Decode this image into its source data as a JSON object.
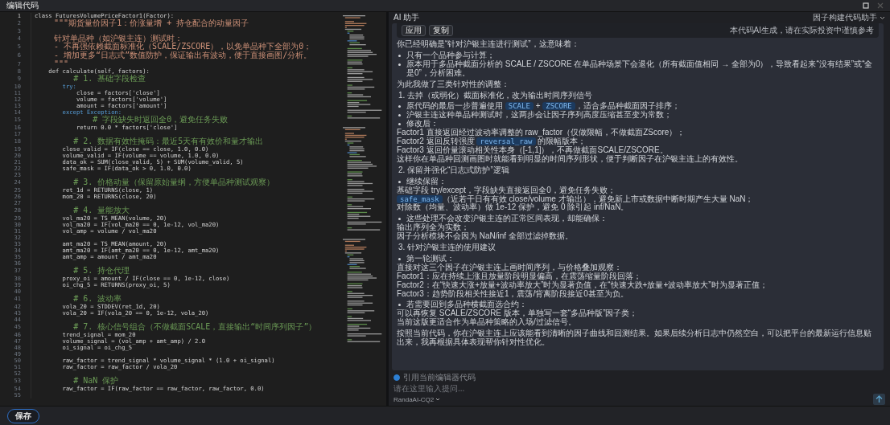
{
  "window": {
    "title": "编辑代码"
  },
  "editor": {
    "lines": [
      {
        "n": "1",
        "kind": "code",
        "text": "class FuturesVolumePriceFactor1(Factor):"
      },
      {
        "n": "2",
        "kind": "doc",
        "text": "    \"\"\"期货量价因子1：价涨量增 + 持仓配合的动量因子"
      },
      {
        "n": "3"
      },
      {
        "n": "4",
        "kind": "doc",
        "text": "    针对单品种（如沪银主连）测试时："
      },
      {
        "n": "5",
        "kind": "doc",
        "text": "    - 不再强依赖截面标准化（SCALE/ZSCORE），以免单品种下全部为0；"
      },
      {
        "n": "6",
        "kind": "doc",
        "text": "    - 增加更多“日志式”数值防护，保证输出有波动，便于直接画图/分析。"
      },
      {
        "n": "7",
        "kind": "doc",
        "text": "    \"\"\""
      },
      {
        "n": "8",
        "kind": "code",
        "text": "    def calculate(self, factors):"
      },
      {
        "n": "9",
        "kind": "comment",
        "text": "        # 1. 基础字段检查"
      },
      {
        "n": "10",
        "kind": "keyword",
        "text": "        try:"
      },
      {
        "n": "11",
        "kind": "code",
        "text": "            close = factors['close']"
      },
      {
        "n": "12",
        "kind": "code",
        "text": "            volume = factors['volume']"
      },
      {
        "n": "13",
        "kind": "code",
        "text": "            amount = factors['amount']"
      },
      {
        "n": "14",
        "kind": "keyword",
        "text": "        except Exception:"
      },
      {
        "n": "15",
        "kind": "comment",
        "text": "            # 字段缺失时返回全0，避免任务失败"
      },
      {
        "n": "16",
        "kind": "code",
        "text": "            return 0.0 * factors['close']"
      },
      {
        "n": "17"
      },
      {
        "n": "18",
        "kind": "comment",
        "text": "        # 2. 数据有效性掩码：最近5天有有效价和量才输出"
      },
      {
        "n": "19",
        "kind": "code",
        "text": "        close_valid = IF(close == close, 1.0, 0.0)"
      },
      {
        "n": "20",
        "kind": "code",
        "text": "        volume_valid = IF(volume == volume, 1.0, 0.0)"
      },
      {
        "n": "21",
        "kind": "code",
        "text": "        data_ok = SUM(close_valid, 5) + SUM(volume_valid, 5)"
      },
      {
        "n": "22",
        "kind": "code",
        "text": "        safe_mask = IF(data_ok > 0, 1.0, 0.0)"
      },
      {
        "n": "23"
      },
      {
        "n": "24",
        "kind": "comment",
        "text": "        # 3. 价格动量（保留原始量纲，方便单品种测试观察）"
      },
      {
        "n": "25",
        "kind": "code",
        "text": "        ret_1d = RETURNS(close, 1)"
      },
      {
        "n": "26",
        "kind": "code",
        "text": "        mom_20 = RETURNS(close, 20)"
      },
      {
        "n": "27"
      },
      {
        "n": "28",
        "kind": "comment",
        "text": "        # 4. 量能放大"
      },
      {
        "n": "29",
        "kind": "code",
        "text": "        vol_ma20 = TS_MEAN(volume, 20)"
      },
      {
        "n": "30",
        "kind": "code",
        "text": "        vol_ma20 = IF(vol_ma20 == 0, 1e-12, vol_ma20)"
      },
      {
        "n": "31",
        "kind": "code",
        "text": "        vol_amp = volume / vol_ma20"
      },
      {
        "n": "32"
      },
      {
        "n": "33",
        "kind": "code",
        "text": "        amt_ma20 = TS_MEAN(amount, 20)"
      },
      {
        "n": "34",
        "kind": "code",
        "text": "        amt_ma20 = IF(amt_ma20 == 0, 1e-12, amt_ma20)"
      },
      {
        "n": "35",
        "kind": "code",
        "text": "        amt_amp = amount / amt_ma20"
      },
      {
        "n": "36"
      },
      {
        "n": "37",
        "kind": "comment",
        "text": "        # 5. 持仓代理"
      },
      {
        "n": "38",
        "kind": "code",
        "text": "        proxy_oi = amount / IF(close == 0, 1e-12, close)"
      },
      {
        "n": "39",
        "kind": "code",
        "text": "        oi_chg_5 = RETURNS(proxy_oi, 5)"
      },
      {
        "n": "40"
      },
      {
        "n": "41",
        "kind": "comment",
        "text": "        # 6. 波动率"
      },
      {
        "n": "42",
        "kind": "code",
        "text": "        vola_20 = STDDEV(ret_1d, 20)"
      },
      {
        "n": "43",
        "kind": "code",
        "text": "        vola_20 = IF(vola_20 == 0, 1e-12, vola_20)"
      },
      {
        "n": "44"
      },
      {
        "n": "45",
        "kind": "comment",
        "text": "        # 7. 核心信号组合（不做截面SCALE，直接输出“时间序列因子”）"
      },
      {
        "n": "46",
        "kind": "code",
        "text": "        trend_signal = mom_20"
      },
      {
        "n": "47",
        "kind": "code",
        "text": "        volume_signal = (vol_amp + amt_amp) / 2.0"
      },
      {
        "n": "48",
        "kind": "code",
        "text": "        oi_signal = oi_chg_5"
      },
      {
        "n": "49"
      },
      {
        "n": "50",
        "kind": "code",
        "text": "        raw_factor = trend_signal * volume_signal * (1.0 + oi_signal)"
      },
      {
        "n": "51",
        "kind": "code",
        "text": "        raw_factor = raw_factor / vola_20"
      },
      {
        "n": "52"
      },
      {
        "n": "53",
        "kind": "comment",
        "text": "        # NaN 保护"
      },
      {
        "n": "54",
        "kind": "code",
        "text": "        raw_factor = IF(raw_factor == raw_factor, raw_factor, 0.0)"
      },
      {
        "n": "55"
      }
    ]
  },
  "assistant": {
    "title": "AI 助手",
    "mode": "因子构建代码助手",
    "card": {
      "buttons": [
        "应用",
        "复制"
      ],
      "note": "本代码AI生成，请在实际投资中谨慎参考"
    },
    "message": [
      [
        {
          "kind": "para",
          "text": "你已经明确是“针对沪银主连进行测试”，这意味着："
        }
      ],
      [
        {
          "kind": "bullet",
          "text": "只有一个品种参与计算；"
        },
        {
          "kind": "bullet",
          "text": "原本用于多品种截面分析的 SCALE / ZSCORE 在单品种场景下会退化（所有截面值相同 → 全部为0），导致看起来“没有结果”或“全是0”，分析困难。"
        }
      ],
      [
        {
          "kind": "para",
          "text": "为此我做了三类针对性的调整："
        }
      ],
      [
        {
          "kind": "heading",
          "text": "1. 去掉（或弱化）截面标准化，改为输出时间序列信号"
        }
      ],
      [
        {
          "kind": "bullet",
          "parts": [
            {
              "text": "原代码的最后一步普遍使用 ",
              "code": false
            },
            {
              "text": "SCALE",
              "code": true
            },
            {
              "text": " + ",
              "code": false
            },
            {
              "text": "ZSCORE",
              "code": true
            },
            {
              "text": "，适合多品种截面因子排序；",
              "code": false
            }
          ]
        },
        {
          "kind": "bullet",
          "text": "沪银主连这种单品种测试时，这两步会让因子序列高度压缩甚至变为常数；"
        },
        {
          "kind": "bullet",
          "text": "修改后："
        },
        {
          "kind": "line",
          "text": "Factor1 直接返回经过波动率调整的 raw_factor（仅做限幅，不做截面ZScore）；"
        },
        {
          "kind": "line",
          "parts": [
            {
              "text": "Factor2 返回反转强度 ",
              "code": false
            },
            {
              "text": "reversal_raw",
              "code": true
            },
            {
              "text": " 的限幅版本；",
              "code": false
            }
          ]
        },
        {
          "kind": "line",
          "text": "Factor3 返回价量滚动相关性本身（[-1,1]），不再做截面SCALE/ZSCORE。"
        },
        {
          "kind": "line",
          "text": "这样你在单品种回测画图时就能看到明显的时间序列形状，便于判断因子在沪银主连上的有效性。"
        }
      ],
      [
        {
          "kind": "heading",
          "text": "2. 保留并强化“日志式防护”逻辑"
        }
      ],
      [
        {
          "kind": "bullet",
          "text": "继续保留："
        },
        {
          "kind": "line",
          "text": "基础字段 try/except，字段缺失直接返回全0，避免任务失败；"
        },
        {
          "kind": "line",
          "parts": [
            {
              "text": "safe_mask",
              "code": true
            },
            {
              "text": "（近若干日有有效 close/volume 才输出），避免新上市或数据中断时期产生大量 NaN；",
              "code": false
            }
          ]
        },
        {
          "kind": "line",
          "text": "对除数（均量、波动率）做 1e-12 保护，避免 0 除引起 inf/NaN。"
        }
      ],
      [
        {
          "kind": "bullet",
          "text": "这些处理不会改变沪银主连的正常区间表现，却能确保："
        },
        {
          "kind": "line",
          "text": "输出序列全为实数；"
        },
        {
          "kind": "line",
          "text": "因子分析模块不会因为 NaN/inf 全部过滤掉数据。"
        }
      ],
      [
        {
          "kind": "heading",
          "text": "3. 针对沪银主连的使用建议"
        }
      ],
      [
        {
          "kind": "bullet",
          "text": "第一轮测试："
        },
        {
          "kind": "line",
          "text": "直接对这三个因子在沪银主连上画时间序列，与价格叠加观察："
        },
        {
          "kind": "line",
          "text": "Factor1：应在持续上涨且放量阶段明显偏高，在震荡缩量阶段回落；"
        },
        {
          "kind": "line",
          "text": "Factor2：在“快速大涨+放量+波动率放大”时为显著负值，在“快速大跌+放量+波动率放大”时为显著正值；"
        },
        {
          "kind": "line",
          "text": "Factor3：趋势阶段相关性接近1，震荡/背离阶段接近0甚至为负。"
        }
      ],
      [
        {
          "kind": "bullet",
          "text": "若需要回到多品种横截面选合约："
        },
        {
          "kind": "line",
          "text": "可以再恢复 SCALE/ZSCORE 版本，单独写一套“多品种版”因子类；"
        },
        {
          "kind": "line",
          "text": "当前这版更适合作为单品种策略的入场/过滤信号。"
        }
      ],
      [
        {
          "kind": "para",
          "text": "按照当前代码，你在沪银主连上应该能看到清晰的因子曲线和回测结果。如果后续分析日志中仍然空白，可以把平台的最新运行信息贴出来，我再根据具体表现帮你针对性优化。"
        }
      ]
    ],
    "input": {
      "reference_label": "引用当前编辑器代码",
      "reference_checked": true,
      "placeholder": "请在这里输入提问...",
      "model": "RandaAI-CQ2"
    }
  },
  "footer": {
    "save": "保存"
  }
}
